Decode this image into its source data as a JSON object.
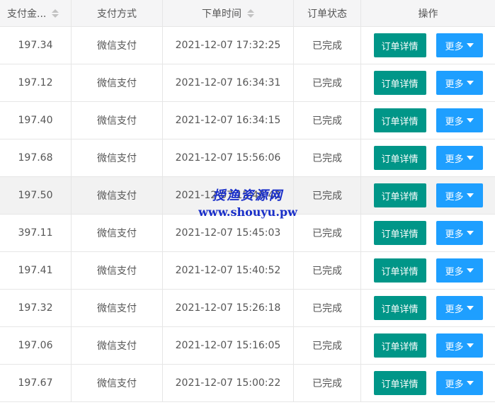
{
  "columns": {
    "amount": "支付金...",
    "method": "支付方式",
    "time": "下单时间",
    "status": "订单状态",
    "actions": "操作"
  },
  "buttons": {
    "detail": "订单详情",
    "more": "更多"
  },
  "rows": [
    {
      "amount": "197.34",
      "method": "微信支付",
      "time": "2021-12-07 17:32:25",
      "status": "已完成"
    },
    {
      "amount": "197.12",
      "method": "微信支付",
      "time": "2021-12-07 16:34:31",
      "status": "已完成"
    },
    {
      "amount": "197.40",
      "method": "微信支付",
      "time": "2021-12-07 16:34:15",
      "status": "已完成"
    },
    {
      "amount": "197.68",
      "method": "微信支付",
      "time": "2021-12-07 15:56:06",
      "status": "已完成"
    },
    {
      "amount": "197.50",
      "method": "微信支付",
      "time": "2021-12-07 15:46:43",
      "status": "已完成"
    },
    {
      "amount": "397.11",
      "method": "微信支付",
      "time": "2021-12-07 15:45:03",
      "status": "已完成"
    },
    {
      "amount": "197.41",
      "method": "微信支付",
      "time": "2021-12-07 15:40:52",
      "status": "已完成"
    },
    {
      "amount": "197.32",
      "method": "微信支付",
      "time": "2021-12-07 15:26:18",
      "status": "已完成"
    },
    {
      "amount": "197.06",
      "method": "微信支付",
      "time": "2021-12-07 15:16:05",
      "status": "已完成"
    },
    {
      "amount": "197.67",
      "method": "微信支付",
      "time": "2021-12-07 15:00:22",
      "status": "已完成"
    }
  ],
  "watermark": {
    "line1": "授渔资源网",
    "line2": "www.shouyu.pw"
  },
  "colors": {
    "detail_button": "#009688",
    "more_button": "#1E9FFF",
    "header_bg": "#f5f5f6",
    "hover_row_bg": "#f2f2f2",
    "watermark": "#1a2fc9"
  }
}
